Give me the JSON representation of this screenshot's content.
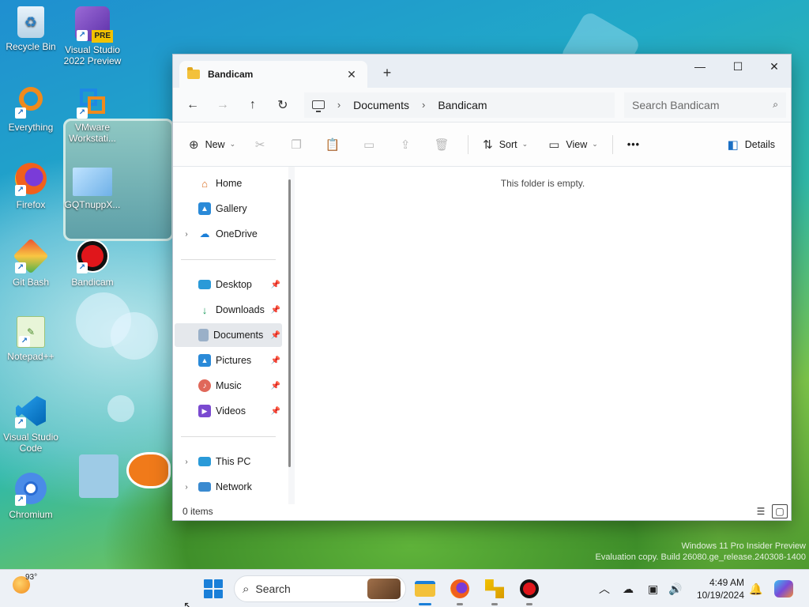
{
  "desktop": {
    "icons": [
      {
        "label": "Recycle Bin"
      },
      {
        "label": "Visual Studio 2022 Preview",
        "badge": "PRE"
      },
      {
        "label": "Everything"
      },
      {
        "label": "VMware Workstati..."
      },
      {
        "label": "Firefox"
      },
      {
        "label": "GQTnuppX..."
      },
      {
        "label": "Git Bash"
      },
      {
        "label": "Bandicam"
      },
      {
        "label": "Notepad++"
      },
      {
        "label": "Visual Studio Code"
      },
      {
        "label": "Chromium"
      }
    ],
    "watermark": {
      "line1": "Windows 11 Pro Insider Preview",
      "line2": "Evaluation copy. Build 26080.ge_release.240308-1400"
    }
  },
  "explorer": {
    "tab_title": "Bandicam",
    "window_controls": {
      "minimize": "—",
      "maximize": "☐",
      "close": "✕"
    },
    "address": {
      "segments": [
        "Documents",
        "Bandicam"
      ]
    },
    "search_placeholder": "Search Bandicam",
    "commands": {
      "new": "New",
      "sort": "Sort",
      "view": "View",
      "more": "•••",
      "details": "Details"
    },
    "nav": {
      "home": "Home",
      "gallery": "Gallery",
      "onedrive": "OneDrive",
      "desktop": "Desktop",
      "downloads": "Downloads",
      "documents": "Documents",
      "pictures": "Pictures",
      "music": "Music",
      "videos": "Videos",
      "thispc": "This PC",
      "network": "Network"
    },
    "empty_message": "This folder is empty.",
    "status_items": "0 items"
  },
  "taskbar": {
    "temperature": "93°",
    "search_label": "Search",
    "time": "4:49 AM",
    "date": "10/19/2024"
  },
  "colors": {
    "accent": "#1a7fd8",
    "folder": "#f3c13a",
    "bandicam_red": "#e0161b"
  }
}
